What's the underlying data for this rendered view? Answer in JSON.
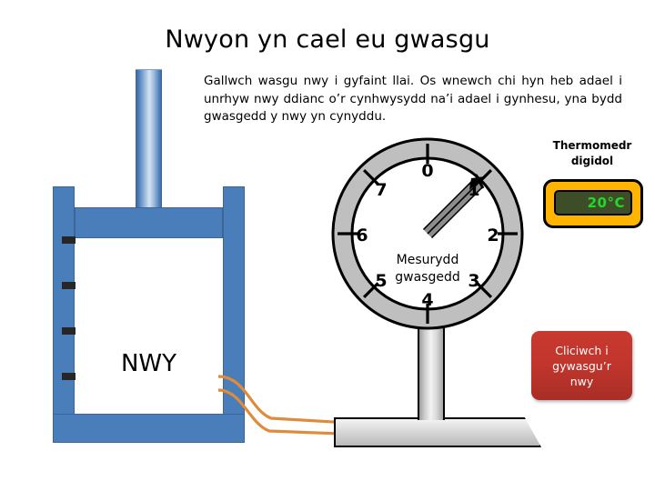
{
  "page": {
    "title": "Nwyon yn cael eu gwasgu",
    "intro": "Gallwch wasgu nwy i gyfaint llai. Os wnewch chi hyn heb adael i unrhyw nwy ddianc o’r cynhwysydd na’i adael i gynhesu, yna bydd gwasgedd y nwy yn cynyddu."
  },
  "container": {
    "gas_label": "NWY",
    "wall_color": "#4a7ebb",
    "gas_color": "#ffffff",
    "tick_count": 4
  },
  "tube": {
    "color": "#e08b3c"
  },
  "gauge": {
    "caption_line1": "Mesurydd",
    "caption_line2": "gwasgedd",
    "numbers": [
      "0",
      "1",
      "2",
      "3",
      "4",
      "5",
      "6",
      "7"
    ],
    "needle_value": "1",
    "needle_angle_deg": 45,
    "face_color": "#ffffff",
    "bezel_color": "#bfbfbf"
  },
  "thermometer": {
    "label_line1": "Thermomedr",
    "label_line2": "digidol",
    "reading": "20°C",
    "body_color": "#ffb400",
    "screen_color": "#3d4d27",
    "text_color": "#22d92b"
  },
  "button": {
    "label_line1": "Cliciwch i",
    "label_line2": "gywasgu’r",
    "label_line3": "nwy",
    "color": "#c0352c"
  }
}
